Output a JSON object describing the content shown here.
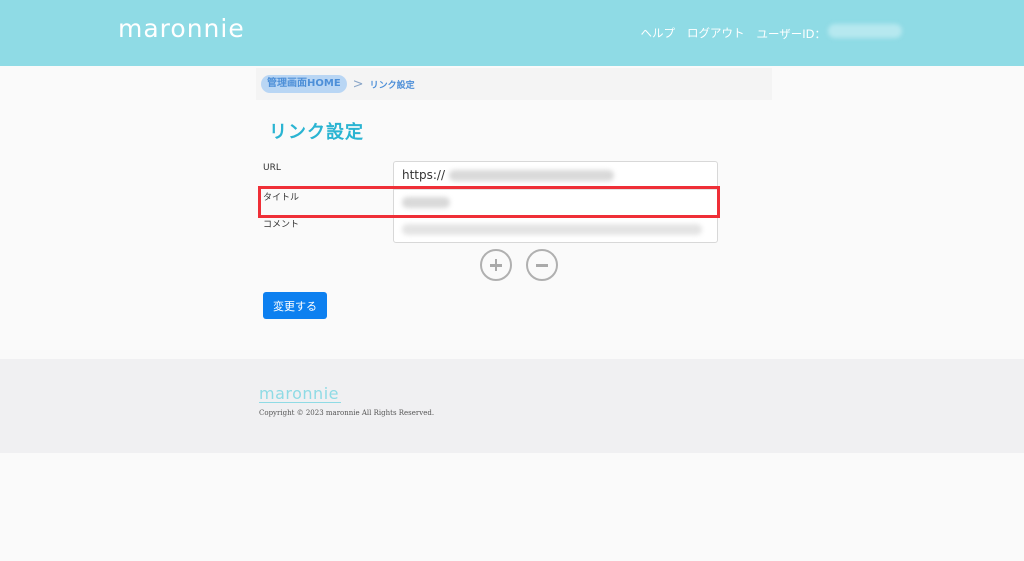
{
  "header": {
    "logo": "maronnie",
    "nav": {
      "help": "ヘルプ",
      "logout": "ログアウト",
      "user_id_label": "ユーザーID："
    }
  },
  "breadcrumb": {
    "home": "管理画面HOME",
    "separator": ">",
    "current": "リンク設定"
  },
  "page": {
    "title": "リンク設定"
  },
  "form": {
    "labels": {
      "url": "URL",
      "title": "タイトル",
      "comment": "コメント"
    },
    "url_prefix": "https://",
    "submit_label": "変更する"
  },
  "footer": {
    "logo": "maronnie",
    "copyright": "Copyright © 2023 maronnie All Rights Reserved."
  },
  "colors": {
    "header_bg": "#8fdbe5",
    "accent": "#2ab4d2",
    "primary_button": "#0d80f0",
    "highlight": "#ef2f37"
  },
  "icons": {
    "add": "plus-circle-icon",
    "remove": "minus-circle-icon"
  }
}
